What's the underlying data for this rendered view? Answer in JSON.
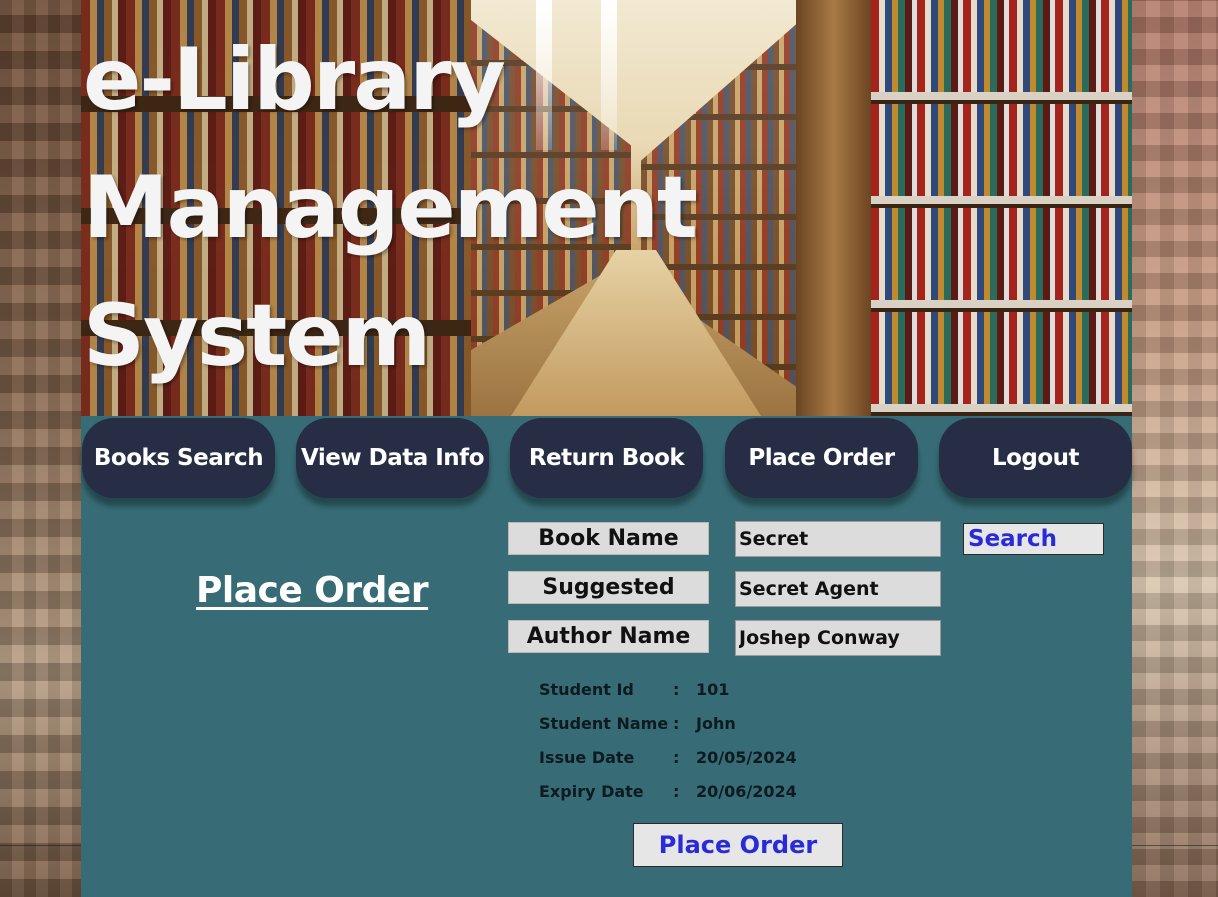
{
  "title": {
    "line1": "e-Library",
    "line2": "Management",
    "line3": "System"
  },
  "nav": [
    {
      "label": "Books Search"
    },
    {
      "label": "View Data Info"
    },
    {
      "label": "Return Book"
    },
    {
      "label": "Place Order"
    },
    {
      "label": "Logout"
    }
  ],
  "section_title": "Place Order",
  "form": {
    "book_name_label": "Book Name",
    "book_name_value": "Secret",
    "suggested_label": "Suggested",
    "suggested_value": "Secret Agent",
    "author_label": "Author Name",
    "author_value": "Joshep Conway",
    "search_label": "Search"
  },
  "student": {
    "id_label": "Student Id",
    "id_value": "101",
    "name_label": "Student Name",
    "name_value": "John",
    "issue_label": "Issue Date",
    "issue_value": "20/05/2024",
    "expiry_label": "Expiry Date",
    "expiry_value": "20/06/2024",
    "separator": ":"
  },
  "place_order_button": "Place Order",
  "colors": {
    "panel": "#376c76",
    "nav_button": "#262d45",
    "action_text": "#2a2bd8"
  }
}
